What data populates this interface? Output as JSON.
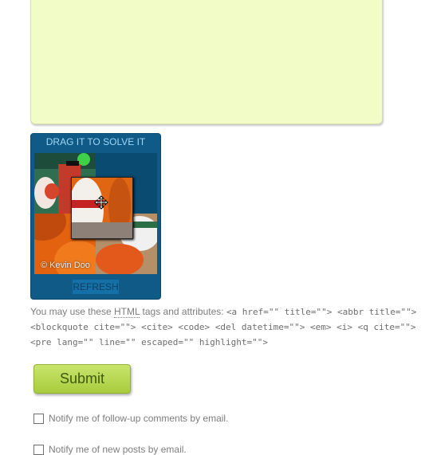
{
  "puzzle": {
    "title": "DRAG IT TO SOLVE IT",
    "watermark": "© Kevin Doo",
    "refresh_label": "REFRESH"
  },
  "allowed_tags": {
    "intro": "You may use these ",
    "abbr": "HTML",
    "after_abbr": " tags and attributes: ",
    "line1_code": "<a href=\"\" title=\"\"> <abbr title=\"\">",
    "line2_code": "<blockquote cite=\"\"> <cite> <code> <del datetime=\"\"> <em> <i> <q cite=\"\">",
    "line3_code": "<pre lang=\"\" line=\"\" escaped=\"\" highlight=\"\">"
  },
  "submit_label": "Submit",
  "notify": {
    "comments_label": "Notify me of follow-up comments by email.",
    "posts_label": "Notify me of new posts by email."
  },
  "colors": {
    "textarea_bg": "#f2fcc6",
    "puzzle_bg": "#0f5a86",
    "submit_green": "#b8d84f"
  }
}
